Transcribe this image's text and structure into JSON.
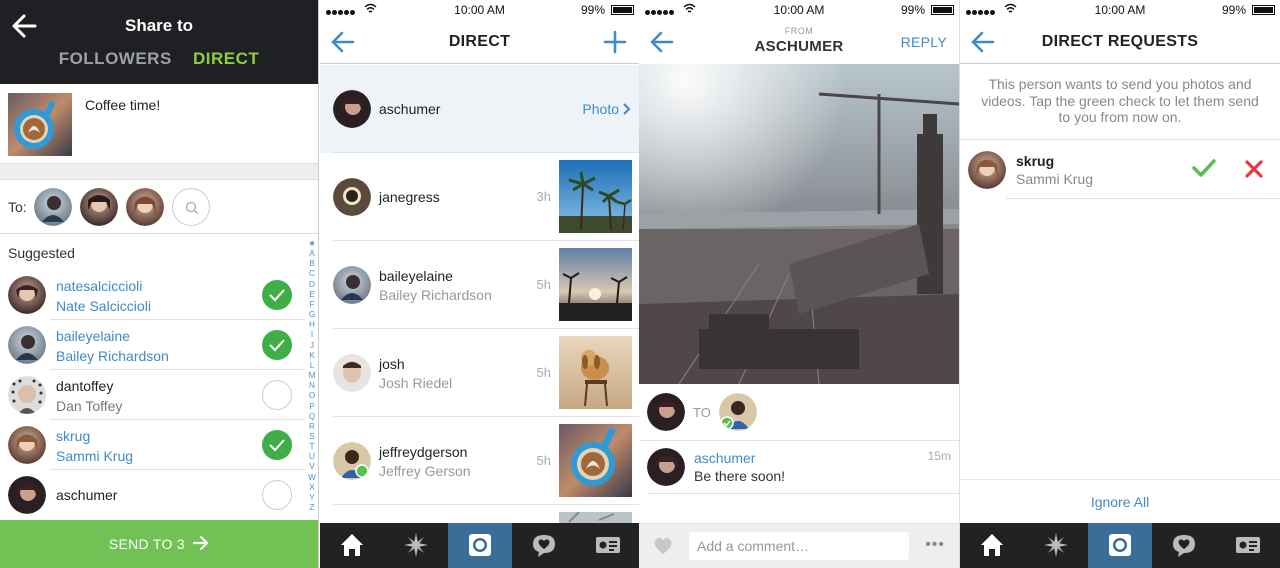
{
  "share_screen": {
    "title": "Share to",
    "tabs": [
      "FOLLOWERS",
      "DIRECT"
    ],
    "caption": "Coffee time!",
    "to_label": "To:",
    "suggested_label": "Suggested",
    "suggestions": [
      {
        "username": "natesalciccioli",
        "name": "Nate Salciccioli",
        "selected": true
      },
      {
        "username": "baileyelaine",
        "name": "Bailey Richardson",
        "selected": true
      },
      {
        "username": "dantoffey",
        "name": "Dan Toffey",
        "selected": false
      },
      {
        "username": "skrug",
        "name": "Sammi Krug",
        "selected": true
      },
      {
        "username": "aschumer",
        "name": "",
        "selected": false
      }
    ],
    "alphabet": [
      "★",
      "A",
      "B",
      "C",
      "D",
      "E",
      "F",
      "G",
      "H",
      "I",
      "J",
      "K",
      "L",
      "M",
      "N",
      "O",
      "P",
      "Q",
      "R",
      "S",
      "T",
      "U",
      "V",
      "W",
      "X",
      "Y",
      "Z"
    ],
    "send_label": "SEND TO 3"
  },
  "status_bar": {
    "time": "10:00 AM",
    "battery": "99%"
  },
  "inbox_screen": {
    "title": "DIRECT",
    "threads": [
      {
        "username": "aschumer",
        "name": "",
        "time": "",
        "action": "Photo"
      },
      {
        "username": "janegress",
        "name": "",
        "time": "3h"
      },
      {
        "username": "baileyelaine",
        "name": "Bailey Richardson",
        "time": "5h"
      },
      {
        "username": "josh",
        "name": "Josh Riedel",
        "time": "5h"
      },
      {
        "username": "jeffreydgerson",
        "name": "Jeffrey Gerson",
        "time": "5h"
      }
    ]
  },
  "message_screen": {
    "from_label": "FROM",
    "from_user": "ASCHUMER",
    "reply_label": "REPLY",
    "to_label": "TO",
    "message": {
      "username": "aschumer",
      "text": "Be there soon!",
      "time": "15m"
    },
    "comment_placeholder": "Add a comment…",
    "more_label": "•••"
  },
  "requests_screen": {
    "title": "DIRECT REQUESTS",
    "intro": "This person wants to send you photos and videos. Tap the green check to let them send to you from now on.",
    "request": {
      "username": "skrug",
      "name": "Sammi Krug"
    },
    "ignore_all": "Ignore All"
  },
  "tabbar": [
    "home-icon",
    "explore-icon",
    "camera-icon",
    "activity-icon",
    "profile-icon"
  ],
  "colors": {
    "accent_blue": "#3d8bc9",
    "direct_green": "#8fce3e",
    "check_green": "#3fae49",
    "send_green": "#72c154",
    "reject_red": "#e8383d",
    "tab_active": "#3a6e99"
  }
}
